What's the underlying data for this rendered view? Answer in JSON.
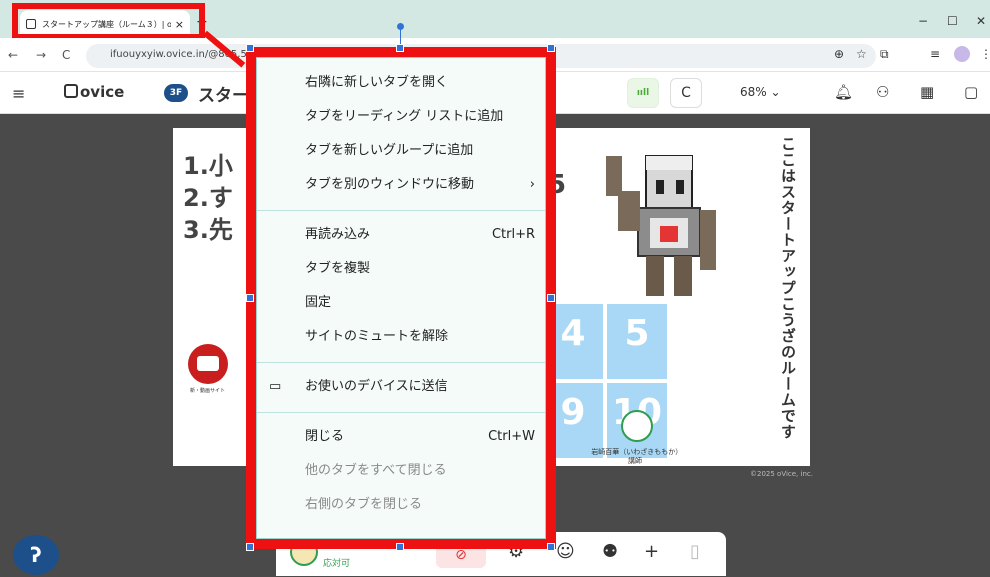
{
  "browser": {
    "tab_title": "スタートアップ講座（ルーム３）| o",
    "tab_close": "×",
    "new_tab": "+",
    "window_controls": [
      "−",
      "☐",
      "✕"
    ],
    "nav": {
      "back": "←",
      "forward": "→",
      "reload": "C"
    },
    "url": "ifuouyxyiw.ovice.in/@865,563",
    "right_icons": [
      "zoom-icon",
      "star-icon",
      "extension-icon",
      "media-icon"
    ]
  },
  "app": {
    "logo_text": "ovice",
    "floor_badge": "3F",
    "room_name": "スター",
    "zoom_label": "68% ⌄",
    "signal_glyph": "ııll",
    "reload_glyph": "C",
    "header_icons": [
      "bell-icon",
      "people-icon",
      "calendar-icon",
      "chat-icon"
    ]
  },
  "slide": {
    "lines": [
      "1.小",
      "2.す",
      "3.先"
    ],
    "digit": "5",
    "video_label": "新・動画サイト",
    "vertical_text": "ここはスタートアップこうざのルームです",
    "numbers": [
      "4",
      "5",
      "9",
      "10"
    ],
    "lecturer_name": "岩崎百華（いわざきももか）講師",
    "copyright": "©2025 oVice, inc."
  },
  "context_menu": {
    "groups": [
      [
        {
          "label": "右隣に新しいタブを開く",
          "shortcut": "",
          "disabled": false
        },
        {
          "label": "タブをリーディング リストに追加",
          "shortcut": "",
          "disabled": false
        },
        {
          "label": "タブを新しいグループに追加",
          "shortcut": "",
          "disabled": false
        },
        {
          "label": "タブを別のウィンドウに移動",
          "shortcut": "›",
          "disabled": false
        }
      ],
      [
        {
          "label": "再読み込み",
          "shortcut": "Ctrl+R",
          "disabled": false
        },
        {
          "label": "タブを複製",
          "shortcut": "",
          "disabled": false
        },
        {
          "label": "固定",
          "shortcut": "",
          "disabled": false
        },
        {
          "label": "サイトのミュートを解除",
          "shortcut": "",
          "disabled": false
        }
      ],
      [
        {
          "label": "お使いのデバイスに送信",
          "shortcut": "",
          "disabled": false,
          "icon": "devices-icon"
        }
      ],
      [
        {
          "label": "閉じる",
          "shortcut": "Ctrl+W",
          "disabled": false
        },
        {
          "label": "他のタブをすべて閉じる",
          "shortcut": "",
          "disabled": true
        },
        {
          "label": "右側のタブを閉じる",
          "shortcut": "",
          "disabled": true
        }
      ]
    ]
  },
  "toolbar": {
    "status_label": "応対可",
    "plus": "+"
  },
  "help_glyph": "ʔ",
  "colors": {
    "highlight": "#ee1111",
    "selection": "#2f73d6",
    "brand": "#1d4f8a",
    "menu_bg": "#f4fbf9"
  }
}
